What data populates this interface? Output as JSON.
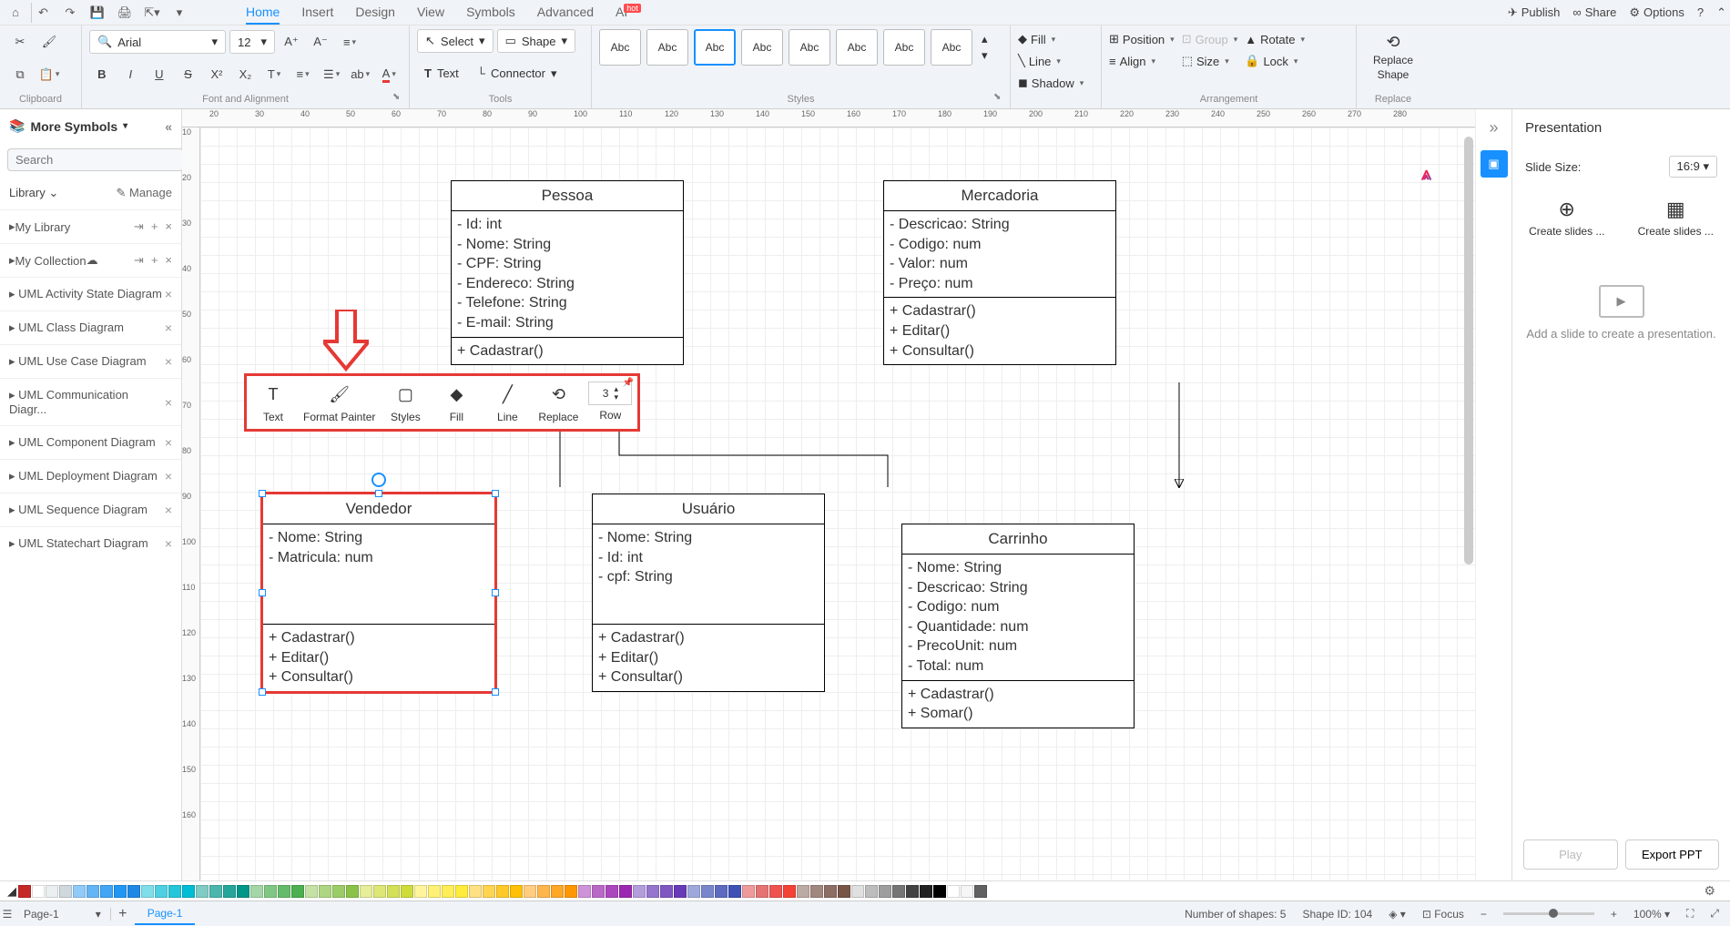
{
  "titlebar": {
    "tabs": [
      "Home",
      "Insert",
      "Design",
      "View",
      "Symbols",
      "Advanced",
      "AI"
    ],
    "active_tab": 0,
    "ai_badge": "hot",
    "right": {
      "publish": "Publish",
      "share": "Share",
      "options": "Options"
    }
  },
  "ribbon": {
    "clipboard": {
      "label": "Clipboard"
    },
    "font": {
      "name": "Arial",
      "size": "12",
      "label": "Font and Alignment"
    },
    "tools": {
      "select": "Select",
      "shape": "Shape",
      "text": "Text",
      "connector": "Connector",
      "label": "Tools"
    },
    "styles": {
      "item": "Abc",
      "label": "Styles"
    },
    "fill": "Fill",
    "line": "Line",
    "shadow": "Shadow",
    "arrangement": {
      "position": "Position",
      "align": "Align",
      "group": "Group",
      "size": "Size",
      "rotate": "Rotate",
      "lock": "Lock",
      "label": "Arrangement"
    },
    "replace": {
      "label": "Replace",
      "btn1": "Replace",
      "btn2": "Shape"
    }
  },
  "sidebar": {
    "more": "More Symbols",
    "search_placeholder": "Search",
    "search_btn": "Search",
    "library": "Library",
    "manage": "Manage",
    "my_library": "My Library",
    "my_collection": "My Collection",
    "categories": [
      "UML Activity State Diagram",
      "UML Class Diagram",
      "UML Use Case Diagram",
      "UML Communication Diagr...",
      "UML Component Diagram",
      "UML Deployment Diagram",
      "UML Sequence Diagram",
      "UML Statechart Diagram"
    ]
  },
  "ruler_h": [
    "20",
    "30",
    "40",
    "50",
    "60",
    "70",
    "80",
    "90",
    "100",
    "110",
    "120",
    "130",
    "140",
    "150",
    "160",
    "170",
    "180",
    "190",
    "200",
    "210",
    "220",
    "230",
    "240",
    "250",
    "260",
    "270",
    "280"
  ],
  "ruler_v": [
    "10",
    "20",
    "30",
    "40",
    "50",
    "60",
    "70",
    "80",
    "90",
    "100",
    "110",
    "120",
    "130",
    "140",
    "150",
    "160"
  ],
  "uml": {
    "pessoa": {
      "name": "Pessoa",
      "attrs": [
        "- Id: int",
        "- Nome: String",
        "- CPF: String",
        "- Endereco: String",
        "- Telefone: String",
        "- E-mail: String"
      ],
      "ops": [
        "+ Cadastrar()"
      ]
    },
    "mercadoria": {
      "name": "Mercadoria",
      "attrs": [
        "- Descricao: String",
        "- Codigo: num",
        "- Valor: num",
        "- Preço: num"
      ],
      "ops": [
        "+ Cadastrar()",
        "+ Editar()",
        "+ Consultar()"
      ]
    },
    "vendedor": {
      "name": "Vendedor",
      "attrs": [
        "- Nome: String",
        "- Matricula: num"
      ],
      "ops": [
        "+ Cadastrar()",
        "+ Editar()",
        "+ Consultar()"
      ]
    },
    "usuario": {
      "name": "Usuário",
      "attrs": [
        "- Nome: String",
        "- Id: int",
        "- cpf: String"
      ],
      "ops": [
        "+ Cadastrar()",
        "+ Editar()",
        "+ Consultar()"
      ]
    },
    "carrinho": {
      "name": "Carrinho",
      "attrs": [
        "- Nome: String",
        "- Descricao: String",
        "- Codigo: num",
        "- Quantidade: num",
        "- PrecoUnit: num",
        "- Total: num"
      ],
      "ops": [
        "+ Cadastrar()",
        "+ Somar()"
      ]
    }
  },
  "float_toolbar": {
    "items": [
      "Text",
      "Format Painter",
      "Styles",
      "Fill",
      "Line",
      "Replace",
      "Row"
    ],
    "row_value": "3"
  },
  "presentation": {
    "title": "Presentation",
    "slide_size_label": "Slide Size:",
    "slide_size_value": "16:9",
    "create1": "Create slides ...",
    "create2": "Create slides ...",
    "placeholder": "Add a slide to create a presentation.",
    "play": "Play",
    "export": "Export PPT"
  },
  "statusbar": {
    "page_dd": "Page-1",
    "page_tab": "Page-1",
    "shapes": "Number of shapes: 5",
    "shape_id": "Shape ID: 104",
    "focus": "Focus",
    "zoom": "100%"
  },
  "palette_colors": [
    "#c62828",
    "#ffffff",
    "#eceff1",
    "#cfd8dc",
    "#90caf9",
    "#64b5f6",
    "#42a5f5",
    "#2196f3",
    "#1e88e5",
    "#80deea",
    "#4dd0e1",
    "#26c6da",
    "#00bcd4",
    "#80cbc4",
    "#4db6ac",
    "#26a69a",
    "#009688",
    "#a5d6a7",
    "#81c784",
    "#66bb6a",
    "#4caf50",
    "#c5e1a5",
    "#aed581",
    "#9ccc65",
    "#8bc34a",
    "#e6ee9c",
    "#dce775",
    "#d4e157",
    "#cddc39",
    "#fff59d",
    "#fff176",
    "#ffee58",
    "#ffeb3b",
    "#ffe082",
    "#ffd54f",
    "#ffca28",
    "#ffc107",
    "#ffcc80",
    "#ffb74d",
    "#ffa726",
    "#ff9800",
    "#ce93d8",
    "#ba68c8",
    "#ab47bc",
    "#9c27b0",
    "#b39ddb",
    "#9575cd",
    "#7e57c2",
    "#673ab7",
    "#9fa8da",
    "#7986cb",
    "#5c6bc0",
    "#3f51b5",
    "#ef9a9a",
    "#e57373",
    "#ef5350",
    "#f44336",
    "#bcaaa4",
    "#a1887f",
    "#8d6e63",
    "#795548",
    "#e0e0e0",
    "#bdbdbd",
    "#9e9e9e",
    "#757575",
    "#424242",
    "#212121",
    "#000000",
    "#ffffff",
    "#f5f5f5",
    "#616161"
  ]
}
